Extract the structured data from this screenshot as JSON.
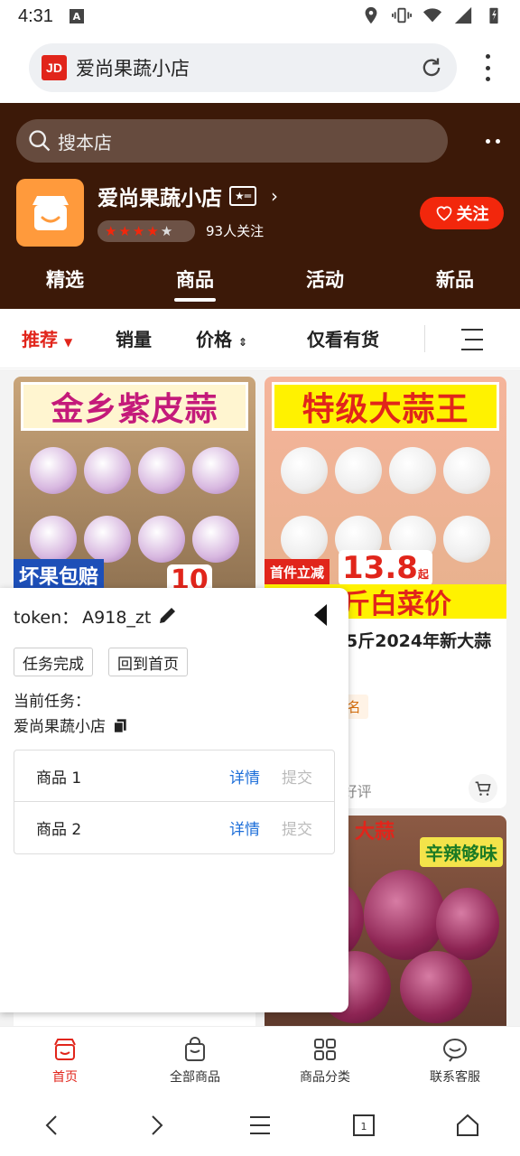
{
  "status_bar": {
    "time": "4:31",
    "notif_icon": "A"
  },
  "browser": {
    "url_text": "爱尚果蔬小店",
    "brand_logo": "JD"
  },
  "shop": {
    "search_placeholder": "搜本店",
    "name": "爱尚果蔬小店",
    "rating_stars": 4.5,
    "followers": "93人关注",
    "follow_button": "关注",
    "tabs": [
      "精选",
      "商品",
      "活动",
      "新品"
    ],
    "active_tab": "商品"
  },
  "sort_bar": {
    "recommend": "推荐",
    "sales": "销量",
    "price": "价格",
    "in_stock": "仅看有货"
  },
  "products": [
    {
      "banner": "金乡紫皮蒜",
      "promo_tag": "坏果包赔",
      "price_tag": "10"
    },
    {
      "banner": "特级大蒜王",
      "promo_tag": "首件立减",
      "price_tag": "13.8",
      "price_suffix": "起",
      "yellow_text": "大蒜5斤白菜价",
      "desc": "蒜头大蒜5斤2024年新大蒜大蒜头...",
      "tag": "椒热销第1名",
      "footer": "评价 74%好评"
    },
    {
      "banner": "大蒜",
      "badge": "辛辣够味"
    }
  ],
  "panel": {
    "token_label": "token：",
    "token_value": "A918_zt",
    "btn_done": "任务完成",
    "btn_home": "回到首页",
    "current_task_label": "当前任务：",
    "current_task": "爱尚果蔬小店",
    "tasks": [
      {
        "name": "商品 1",
        "detail": "详情",
        "submit": "提交"
      },
      {
        "name": "商品 2",
        "detail": "详情",
        "submit": "提交"
      }
    ]
  },
  "bottom_nav": [
    {
      "label": "首页",
      "icon": "shop-icon"
    },
    {
      "label": "全部商品",
      "icon": "bag-icon"
    },
    {
      "label": "商品分类",
      "icon": "grid-icon"
    },
    {
      "label": "联系客服",
      "icon": "chat-icon"
    }
  ],
  "colors": {
    "header_bg": "#3c1908",
    "accent": "#e1251b",
    "link": "#1e6fd9"
  }
}
